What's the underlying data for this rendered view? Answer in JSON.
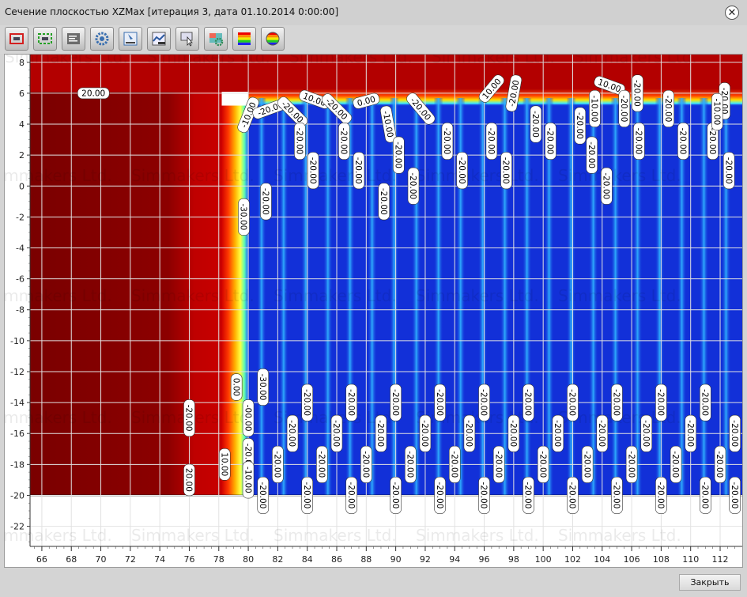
{
  "window": {
    "title": "Сечение плоскостью XZMax [итерация 3, дата 01.10.2014 0:00:00]",
    "close_glyph": "✕"
  },
  "watermark": "Simmakers Ltd.",
  "toolbar": {
    "buttons": [
      {
        "name": "fit-view-icon",
        "accent": "#d32020"
      },
      {
        "name": "zoom-extents-icon",
        "accent": "#22a022"
      },
      {
        "name": "legend-panel-icon",
        "accent": "#444444"
      },
      {
        "name": "settings-gear-icon",
        "accent": "#3a6fb0"
      },
      {
        "name": "export-image-icon",
        "accent": "#3a6fb0"
      },
      {
        "name": "chart-graph-icon",
        "accent": "#2c5aa0"
      },
      {
        "name": "pointer-info-icon",
        "accent": "#3a6fb0"
      },
      {
        "name": "color-settings-icon",
        "accent": "#2e8b57"
      },
      {
        "name": "color-scale-icon",
        "accent": "#ff0000"
      },
      {
        "name": "color-wheel-icon",
        "accent": "#ffa500"
      }
    ]
  },
  "plot": {
    "x_ticks": [
      66,
      68,
      70,
      72,
      74,
      76,
      78,
      80,
      82,
      84,
      86,
      88,
      90,
      92,
      94,
      96,
      98,
      100,
      102,
      104,
      106,
      108,
      110,
      112
    ],
    "y_ticks": [
      8,
      6,
      4,
      2,
      0,
      -2,
      -4,
      -6,
      -8,
      -10,
      -12,
      -14,
      -16,
      -18,
      -20,
      -22
    ],
    "x_range": [
      65.2,
      113.5
    ],
    "y_range": [
      -23.3,
      8.5
    ],
    "field_top_depth": 6.4,
    "field_bottom_depth": -20.0,
    "warm_edge_x": 78.2,
    "cold_edge_x": 80.0,
    "colors": {
      "warm_dark": "#8a0000",
      "warm": "#b30000",
      "cold": "#1230d8",
      "cold_stripe": "#27a7ff"
    },
    "contour_labels": [
      {
        "text": "20.00",
        "x": 69.5,
        "y": 6.0,
        "rot": 0
      },
      {
        "text": "-10.00",
        "x": 80.0,
        "y": 4.6,
        "rot": -68
      },
      {
        "text": "-20.00",
        "x": 81.5,
        "y": 5.0,
        "rot": -20
      },
      {
        "text": "-20.00",
        "x": 83.0,
        "y": 4.8,
        "rot": 45
      },
      {
        "text": "10.00",
        "x": 84.5,
        "y": 5.6,
        "rot": 20
      },
      {
        "text": "-20.00",
        "x": 86.0,
        "y": 5.0,
        "rot": 45
      },
      {
        "text": "0.00",
        "x": 88.0,
        "y": 5.5,
        "rot": -15
      },
      {
        "text": "-10.00",
        "x": 89.5,
        "y": 4.0,
        "rot": 80
      },
      {
        "text": "-20.00",
        "x": 91.7,
        "y": 5.0,
        "rot": 50
      },
      {
        "text": "10.00",
        "x": 96.5,
        "y": 6.3,
        "rot": -50
      },
      {
        "text": "-20.00",
        "x": 98.0,
        "y": 6.0,
        "rot": -80
      },
      {
        "text": "10.00",
        "x": 104.5,
        "y": 6.5,
        "rot": 20
      },
      {
        "text": "-20.00",
        "x": 106.4,
        "y": 6.0,
        "rot": 90
      },
      {
        "text": "-20.00",
        "x": 112.3,
        "y": 5.5,
        "rot": 90
      },
      {
        "text": "-20.00",
        "x": 83.5,
        "y": 2.9,
        "rot": 90
      },
      {
        "text": "-20.00",
        "x": 84.4,
        "y": 1.0,
        "rot": 90
      },
      {
        "text": "-20.00",
        "x": 86.5,
        "y": 2.9,
        "rot": 90
      },
      {
        "text": "-20.00",
        "x": 87.5,
        "y": 1.0,
        "rot": 90
      },
      {
        "text": "-20.00",
        "x": 90.2,
        "y": 2.0,
        "rot": 90
      },
      {
        "text": "-20.00",
        "x": 91.2,
        "y": 0.0,
        "rot": 90
      },
      {
        "text": "-20.00",
        "x": 89.2,
        "y": -1.0,
        "rot": 90
      },
      {
        "text": "-20.00",
        "x": 93.5,
        "y": 2.9,
        "rot": 90
      },
      {
        "text": "-20.00",
        "x": 94.5,
        "y": 1.0,
        "rot": 90
      },
      {
        "text": "-20.00",
        "x": 96.5,
        "y": 2.9,
        "rot": 90
      },
      {
        "text": "-20.00",
        "x": 97.5,
        "y": 1.0,
        "rot": 90
      },
      {
        "text": "-20.00",
        "x": 99.5,
        "y": 4.0,
        "rot": 90
      },
      {
        "text": "-20.00",
        "x": 100.5,
        "y": 2.9,
        "rot": 90
      },
      {
        "text": "-20.00",
        "x": 102.5,
        "y": 3.9,
        "rot": 90
      },
      {
        "text": "-10.00",
        "x": 103.5,
        "y": 5.0,
        "rot": 90
      },
      {
        "text": "-20.00",
        "x": 103.3,
        "y": 2.0,
        "rot": 90
      },
      {
        "text": "-20.00",
        "x": 104.3,
        "y": 0.0,
        "rot": 90
      },
      {
        "text": "-20.00",
        "x": 105.5,
        "y": 5.0,
        "rot": 90
      },
      {
        "text": "-20.00",
        "x": 106.5,
        "y": 2.9,
        "rot": 90
      },
      {
        "text": "-20.00",
        "x": 108.5,
        "y": 5.0,
        "rot": 90
      },
      {
        "text": "-20.00",
        "x": 109.5,
        "y": 2.9,
        "rot": 90
      },
      {
        "text": "-20.00",
        "x": 111.5,
        "y": 2.9,
        "rot": 90
      },
      {
        "text": "-10.00",
        "x": 111.8,
        "y": 4.8,
        "rot": 90
      },
      {
        "text": "-20.00",
        "x": 112.6,
        "y": 1.0,
        "rot": 90
      },
      {
        "text": "-20.00",
        "x": 81.2,
        "y": -1.0,
        "rot": 90
      },
      {
        "text": "-30.00",
        "x": 79.7,
        "y": -2.0,
        "rot": 90
      },
      {
        "text": "0.00",
        "x": 79.2,
        "y": -13.0,
        "rot": 90
      },
      {
        "text": "-30.00",
        "x": 81.0,
        "y": -13.0,
        "rot": 90
      },
      {
        "text": "-20.00",
        "x": 76.0,
        "y": -15.0,
        "rot": 90
      },
      {
        "text": "-00.00",
        "x": 80.0,
        "y": -15.0,
        "rot": 90
      },
      {
        "text": "-20.00",
        "x": 80.0,
        "y": -17.5,
        "rot": 90
      },
      {
        "text": "10.00",
        "x": 78.4,
        "y": -18.0,
        "rot": 90
      },
      {
        "text": "20.00",
        "x": 76.0,
        "y": -19.0,
        "rot": 90
      },
      {
        "text": "-10.00",
        "x": 80.0,
        "y": -19.0,
        "rot": 90
      },
      {
        "text": "-20.00",
        "x": 84.0,
        "y": -14.0,
        "rot": 90
      },
      {
        "text": "-20.00",
        "x": 87.0,
        "y": -14.0,
        "rot": 90
      },
      {
        "text": "-20.00",
        "x": 90.0,
        "y": -14.0,
        "rot": 90
      },
      {
        "text": "-20.00",
        "x": 93.0,
        "y": -14.0,
        "rot": 90
      },
      {
        "text": "-20.00",
        "x": 96.0,
        "y": -14.0,
        "rot": 90
      },
      {
        "text": "-20.00",
        "x": 99.0,
        "y": -14.0,
        "rot": 90
      },
      {
        "text": "-20.00",
        "x": 102.0,
        "y": -14.0,
        "rot": 90
      },
      {
        "text": "-20.00",
        "x": 105.0,
        "y": -14.0,
        "rot": 90
      },
      {
        "text": "-20.00",
        "x": 108.0,
        "y": -14.0,
        "rot": 90
      },
      {
        "text": "-20.00",
        "x": 111.0,
        "y": -14.0,
        "rot": 90
      },
      {
        "text": "-20.00",
        "x": 83.0,
        "y": -16.0,
        "rot": 90
      },
      {
        "text": "-20.00",
        "x": 86.0,
        "y": -16.0,
        "rot": 90
      },
      {
        "text": "-20.00",
        "x": 89.0,
        "y": -16.0,
        "rot": 90
      },
      {
        "text": "-20.00",
        "x": 92.0,
        "y": -16.0,
        "rot": 90
      },
      {
        "text": "-20.00",
        "x": 95.0,
        "y": -16.0,
        "rot": 90
      },
      {
        "text": "-20.00",
        "x": 98.0,
        "y": -16.0,
        "rot": 90
      },
      {
        "text": "-20.00",
        "x": 101.0,
        "y": -16.0,
        "rot": 90
      },
      {
        "text": "-20.00",
        "x": 104.0,
        "y": -16.0,
        "rot": 90
      },
      {
        "text": "-20.00",
        "x": 107.0,
        "y": -16.0,
        "rot": 90
      },
      {
        "text": "-20.00",
        "x": 110.0,
        "y": -16.0,
        "rot": 90
      },
      {
        "text": "-20.00",
        "x": 113.0,
        "y": -16.0,
        "rot": 90
      },
      {
        "text": "-20.00",
        "x": 82.0,
        "y": -18.0,
        "rot": 90
      },
      {
        "text": "-20.00",
        "x": 85.0,
        "y": -18.0,
        "rot": 90
      },
      {
        "text": "-20.00",
        "x": 88.0,
        "y": -18.0,
        "rot": 90
      },
      {
        "text": "-20.00",
        "x": 91.0,
        "y": -18.0,
        "rot": 90
      },
      {
        "text": "-20.00",
        "x": 94.0,
        "y": -18.0,
        "rot": 90
      },
      {
        "text": "-20.00",
        "x": 97.0,
        "y": -18.0,
        "rot": 90
      },
      {
        "text": "-20.00",
        "x": 100.0,
        "y": -18.0,
        "rot": 90
      },
      {
        "text": "-20.00",
        "x": 103.0,
        "y": -18.0,
        "rot": 90
      },
      {
        "text": "-20.00",
        "x": 106.0,
        "y": -18.0,
        "rot": 90
      },
      {
        "text": "-20.00",
        "x": 109.0,
        "y": -18.0,
        "rot": 90
      },
      {
        "text": "-20.00",
        "x": 112.0,
        "y": -18.0,
        "rot": 90
      },
      {
        "text": "-20.00",
        "x": 81.0,
        "y": -20.0,
        "rot": 90
      },
      {
        "text": "-20.00",
        "x": 84.0,
        "y": -20.0,
        "rot": 90
      },
      {
        "text": "-20.00",
        "x": 87.0,
        "y": -20.0,
        "rot": 90
      },
      {
        "text": "-20.00",
        "x": 90.0,
        "y": -20.0,
        "rot": 90
      },
      {
        "text": "-20.00",
        "x": 93.0,
        "y": -20.0,
        "rot": 90
      },
      {
        "text": "-20.00",
        "x": 96.0,
        "y": -20.0,
        "rot": 90
      },
      {
        "text": "-20.00",
        "x": 99.0,
        "y": -20.0,
        "rot": 90
      },
      {
        "text": "-20.00",
        "x": 102.0,
        "y": -20.0,
        "rot": 90
      },
      {
        "text": "-20.00",
        "x": 105.0,
        "y": -20.0,
        "rot": 90
      },
      {
        "text": "-20.00",
        "x": 108.0,
        "y": -20.0,
        "rot": 90
      },
      {
        "text": "-20.00",
        "x": 111.0,
        "y": -20.0,
        "rot": 90
      },
      {
        "text": "-20.00",
        "x": 113.0,
        "y": -20.0,
        "rot": 90
      }
    ]
  },
  "footer": {
    "close_label": "Закрыть"
  }
}
